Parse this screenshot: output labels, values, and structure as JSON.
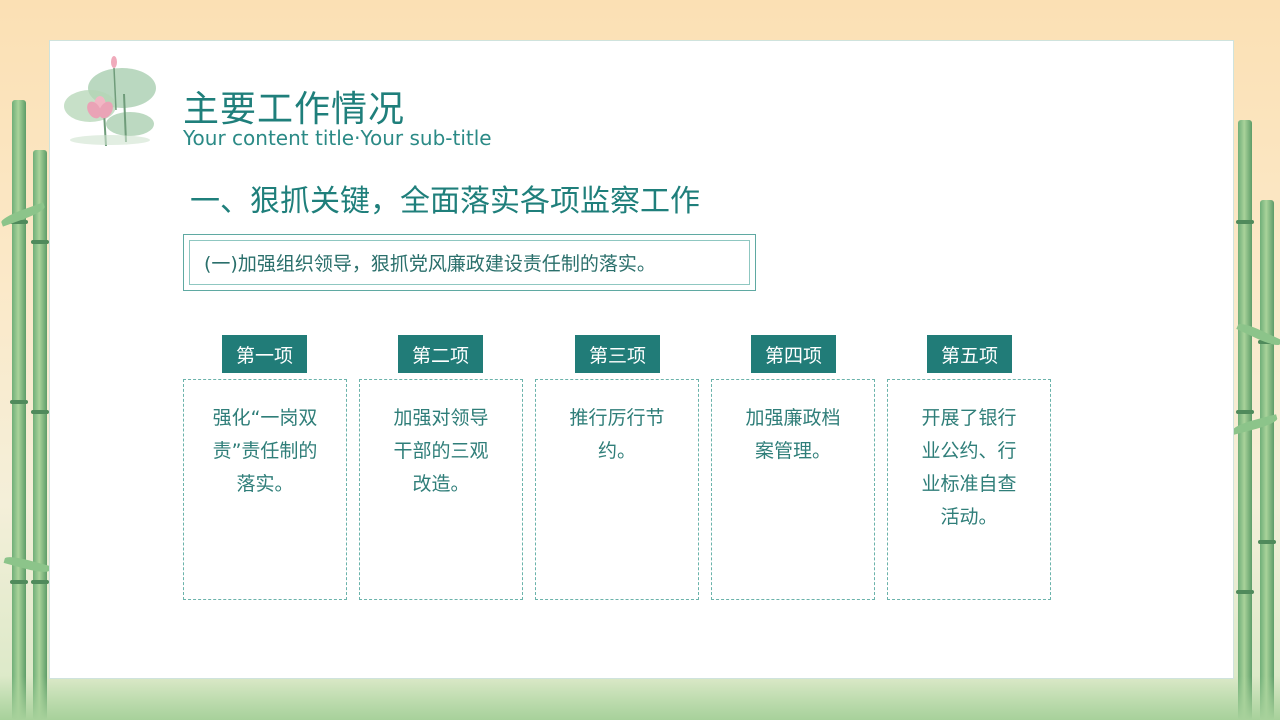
{
  "header": {
    "title": "主要工作情况",
    "subtitle": "Your content title·Your sub-title"
  },
  "section": {
    "heading": "一、狠抓关键，全面落实各项监察工作",
    "subsection": "(一)加强组织领导，狠抓党风廉政建设责任制的落实。"
  },
  "items": [
    {
      "tag": "第一项",
      "text": "强化“一岗双责”责任制的落实。"
    },
    {
      "tag": "第二项",
      "text": "加强对领导干部的三观改造。"
    },
    {
      "tag": "第三项",
      "text": "推行厉行节约。"
    },
    {
      "tag": "第四项",
      "text": "加强廉政档案管理。"
    },
    {
      "tag": "第五项",
      "text": "开展了银行业公约、行业标准自查活动。"
    }
  ],
  "colors": {
    "accent": "#217c78",
    "title": "#1f7f7b",
    "border": "#6bb3ab"
  },
  "icons": {
    "decoration": "lotus-illustration-icon"
  }
}
